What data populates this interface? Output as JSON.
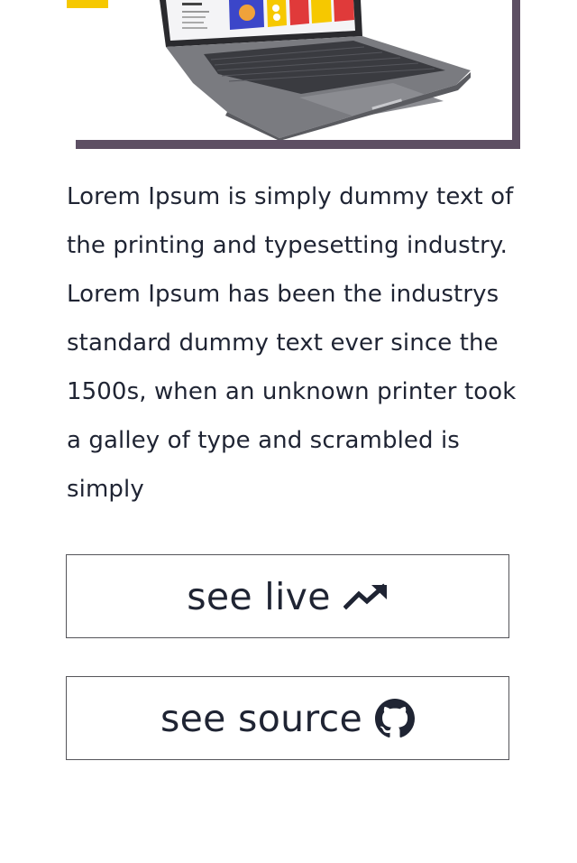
{
  "project": {
    "image_alt_icon": "laptop-icon",
    "accent_colors": {
      "frame": "#5d4f63",
      "yellow": "#f6c800",
      "text": "#1f2433"
    },
    "description": "Lorem Ipsum is simply dummy text of the printing and typesetting industry. Lorem Ipsum has been the industrys standard dummy text ever since the 1500s, when an unknown printer took a galley of type and scrambled is simply"
  },
  "actions": {
    "live": {
      "label": "see live",
      "icon": "trending-up-icon"
    },
    "source": {
      "label": "see source",
      "icon": "github-icon"
    }
  }
}
